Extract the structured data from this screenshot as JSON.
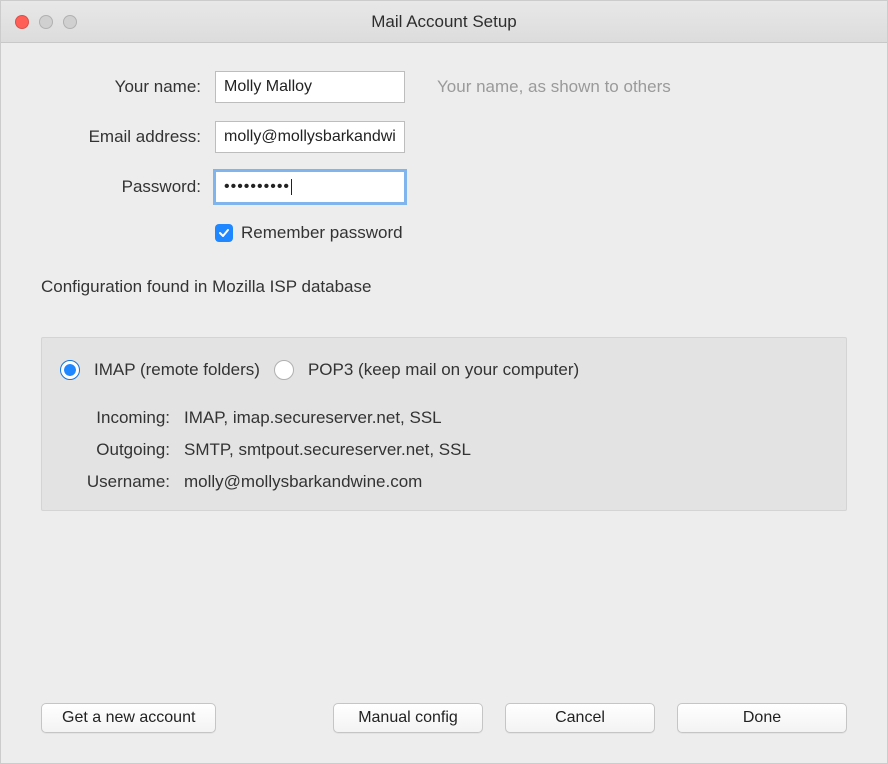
{
  "window": {
    "title": "Mail Account Setup"
  },
  "form": {
    "name_label": "Your name:",
    "name_value": "Molly Malloy",
    "name_hint": "Your name, as shown to others",
    "email_label": "Email address:",
    "email_value": "molly@mollysbarkandwi",
    "password_label": "Password:",
    "password_masked": "••••••••••",
    "remember_label": "Remember password",
    "remember_checked": true
  },
  "status": "Configuration found in Mozilla ISP database",
  "protocol": {
    "imap_label": "IMAP (remote folders)",
    "pop3_label": "POP3 (keep mail on your computer)",
    "selected": "imap"
  },
  "servers": {
    "incoming_label": "Incoming:",
    "incoming_value": "IMAP, imap.secureserver.net, SSL",
    "outgoing_label": "Outgoing:",
    "outgoing_value": "SMTP, smtpout.secureserver.net, SSL",
    "username_label": "Username:",
    "username_value": "molly@mollysbarkandwine.com"
  },
  "buttons": {
    "new_account": "Get a new account",
    "manual": "Manual config",
    "cancel": "Cancel",
    "done": "Done"
  }
}
